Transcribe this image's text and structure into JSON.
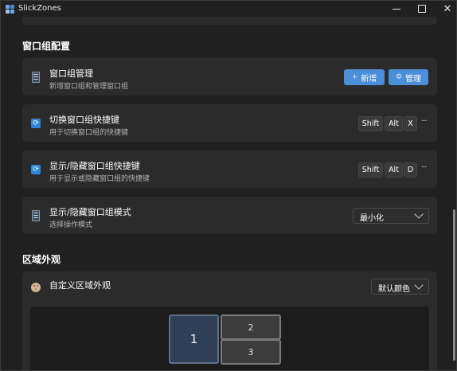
{
  "app": {
    "title": "SlickZones"
  },
  "sections": {
    "window_groups": "窗口组配置",
    "zone_appearance": "区域外观"
  },
  "cards": {
    "manage": {
      "title": "窗口组管理",
      "subtitle": "新增窗口组和管理窗口组",
      "icon": "document-list-icon",
      "add_label": "新增",
      "manage_label": "管理"
    },
    "switch_hotkey": {
      "title": "切换窗口组快捷键",
      "subtitle": "用于切换窗口组的快捷键",
      "icon": "sync-icon",
      "keys": [
        "Shift",
        "Alt",
        "X"
      ],
      "more": "···"
    },
    "toggle_hotkey": {
      "title": "显示/隐藏窗口组快捷键",
      "subtitle": "用于显示或隐藏窗口组的快捷键",
      "icon": "sync-icon",
      "keys": [
        "Shift",
        "Alt",
        "D"
      ],
      "more": "···"
    },
    "toggle_mode": {
      "title": "显示/隐藏窗口组模式",
      "subtitle": "选择操作模式",
      "icon": "document-list-icon",
      "selected": "最小化"
    },
    "custom_appearance": {
      "title": "自定义区域外观",
      "icon": "palette-icon",
      "selected": "默认颜色",
      "zones": [
        "1",
        "2",
        "3"
      ]
    }
  },
  "colors": {
    "background": "#202020",
    "card": "#2b2b2b",
    "accent": "#4a8fd8",
    "zone_active": "#2f3f55"
  }
}
